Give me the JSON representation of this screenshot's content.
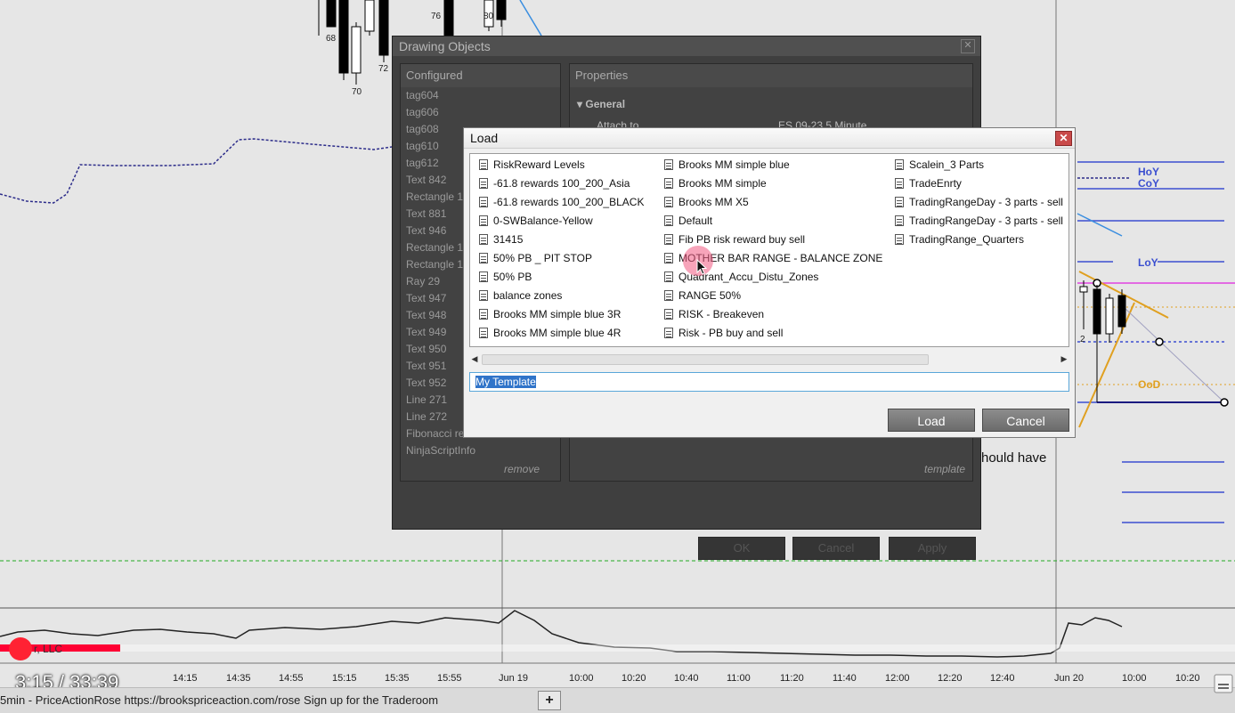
{
  "chart": {
    "bar_labels": [
      "68",
      "70",
      "72",
      "76",
      "80",
      "2"
    ],
    "level_labels": {
      "hoy": "HoY",
      "coy": "CoY",
      "loy": "LoY",
      "ood": "OoD"
    },
    "overlay_text": "hould have",
    "copyright": "r, LLC",
    "time_axis": [
      "14:15",
      "14:35",
      "14:55",
      "15:15",
      "15:35",
      "15:55",
      "Jun 19",
      "10:00",
      "10:20",
      "10:40",
      "11:00",
      "11:20",
      "11:40",
      "12:00",
      "12:20",
      "12:40",
      "Jun 20",
      "10:00",
      "10:20"
    ],
    "colors": {
      "level_blue": "#3b4fd0",
      "level_orange": "#e0a020",
      "level_magenta": "#e040e0",
      "green_dashed": "#22aa22"
    }
  },
  "drawing_objects": {
    "title": "Drawing Objects",
    "configured_header": "Configured",
    "configured_items": [
      "tag604",
      "tag606",
      "tag608",
      "tag610",
      "tag612",
      "Text 842",
      "Rectangle 1",
      "Text 881",
      "Text 946",
      "Rectangle 1",
      "Rectangle 1",
      "Ray 29",
      "Text 947",
      "Text 948",
      "Text 949",
      "Text 950",
      "Text 951",
      "Text 952",
      "Line 271",
      "Line 272",
      "Fibonacci retracements",
      "NinjaScriptInfo"
    ],
    "remove_link": "remove",
    "properties_header": "Properties",
    "general_section": "General",
    "attach_to_label": "Attach to",
    "attach_to_value": "ES 09-23 5 Minute",
    "template_link": "template",
    "ok_label": "OK",
    "cancel_label": "Cancel",
    "apply_label": "Apply"
  },
  "load_dialog": {
    "title": "Load",
    "columns": [
      [
        "RiskReward Levels",
        "-61.8 rewards 100_200_Asia",
        "-61.8 rewards 100_200_BLACK",
        "0-SWBalance-Yellow",
        "31415",
        "50% PB _ PIT STOP",
        "50% PB",
        "balance zones",
        "Brooks MM simple blue 3R",
        "Brooks MM simple blue 4R"
      ],
      [
        "Brooks MM simple blue",
        "Brooks MM simple",
        "Brooks MM X5",
        "Default",
        "Fib PB risk reward buy sell",
        "MOTHER BAR RANGE - BALANCE ZONE",
        "Quadrant_Accu_Distu_Zones",
        "RANGE 50%",
        "RISK - Breakeven",
        "Risk - PB buy and sell"
      ],
      [
        "Scalein_3 Parts",
        "TradeEnrty",
        "TradingRangeDay - 3 parts - sell",
        "TradingRangeDay - 3 parts - sell",
        "TradingRange_Quarters"
      ]
    ],
    "template_value": "My Template",
    "load_label": "Load",
    "cancel_label": "Cancel"
  },
  "status_bar": {
    "tab_label": "5min - PriceActionRose https://brookspriceaction.com/rose Sign up for the Traderoom",
    "add_tab": "+"
  },
  "video": {
    "time": "3:15 / 33:39",
    "progress_fraction": 0.097
  }
}
